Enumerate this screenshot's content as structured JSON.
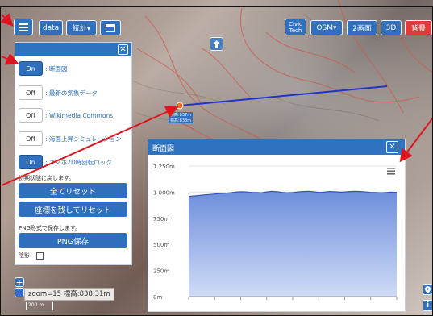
{
  "toolbar": {
    "menu_icon": "hamburger-icon",
    "data_label": "data",
    "stats_label": "統計▾",
    "calendar_icon": "calendar-icon",
    "civic_line1": "Civic",
    "civic_line2": "Tech",
    "osm_label": "OSM▾",
    "split_label": "2画面",
    "three_d_label": "3D",
    "background_label": "背景"
  },
  "panel": {
    "close_glyph": "✕",
    "toggles": [
      {
        "state": "On",
        "label": ": 断面図"
      },
      {
        "state": "Off",
        "label": ": 最新の気象データ"
      },
      {
        "state": "Off",
        "label": ": Wikimedia Commons"
      },
      {
        "state": "Off",
        "label": ": 海面上昇シミュレーション"
      },
      {
        "state": "On",
        "label": ": スマホ2D時回転ロック"
      }
    ],
    "reset_note": "初期状態に戻します。",
    "reset_all": "全てリセット",
    "reset_keep_coords": "座標を残してリセット",
    "png_note": "PNG形式で保存します。",
    "png_save": "PNG保存",
    "shadow_label": "陰影：",
    "shadow_checked": false
  },
  "chart_panel": {
    "title": "断面図",
    "close_glyph": "✕",
    "menu_icon": "chart-menu-icon"
  },
  "chart_data": {
    "type": "area",
    "x": [
      0,
      1,
      2,
      3,
      4,
      5,
      6,
      7,
      8,
      9,
      10,
      11,
      12,
      13,
      14,
      15,
      16,
      17,
      18,
      19,
      20,
      21,
      22,
      23,
      24,
      25,
      26,
      27,
      28,
      29,
      30,
      31,
      32,
      33,
      34,
      35,
      36,
      37,
      38,
      39,
      40
    ],
    "values": [
      960,
      964,
      968,
      974,
      978,
      982,
      986,
      990,
      994,
      1000,
      1004,
      1002,
      998,
      996,
      994,
      1002,
      1008,
      1004,
      998,
      994,
      996,
      1002,
      1006,
      1008,
      1004,
      998,
      1000,
      1006,
      1004,
      1000,
      1002,
      1006,
      1008,
      1006,
      1002,
      998,
      996,
      994,
      996,
      1000,
      998
    ],
    "y_ticks": [
      "0m",
      "250m",
      "500m",
      "750m",
      "1 000m",
      "1 250m"
    ],
    "ylim": [
      0,
      1250
    ],
    "grid": true
  },
  "markers": {
    "point_label_1": "標高:837m",
    "point_label_2": "標高:838m"
  },
  "status": {
    "text": "zoom=15 標高:838.31m"
  },
  "scale": {
    "label": "200 m"
  },
  "map_controls": {
    "zoom_in": "+",
    "zoom_out": "−",
    "locate_icon": "location-pin-icon",
    "info_icon": "info-icon",
    "upload_icon": "upload-icon"
  },
  "colors": {
    "accent": "#2f6fbd",
    "panel_header": "#2f73c0",
    "alert_red": "#e03a3a",
    "arrow_red": "#e0141e",
    "profile_line": "#2233cc"
  }
}
